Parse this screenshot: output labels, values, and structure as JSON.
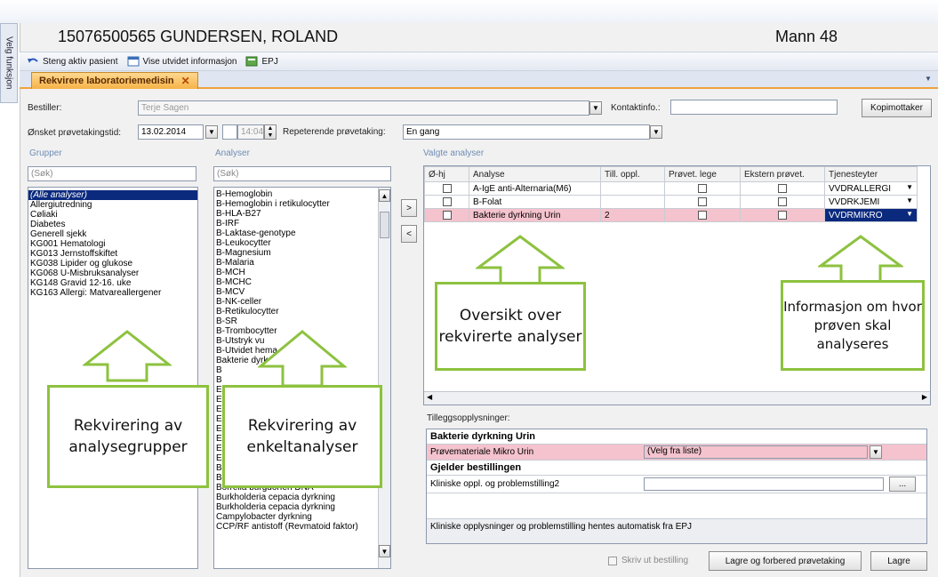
{
  "side_tab": "Velg funksjon",
  "patient": {
    "name": "15076500565 GUNDERSEN, ROLAND",
    "info": "Mann 48"
  },
  "toolbar": {
    "close_patient": "Steng aktiv pasient",
    "extended_info": "Vise utvidet informasjon",
    "epj": "EPJ"
  },
  "tab": {
    "label": "Rekvirere laboratoriemedisin",
    "close": "✕"
  },
  "form": {
    "bestiller_label": "Bestiller:",
    "bestiller_value": "Terje Sagen",
    "kontakt_label": "Kontaktinfo.:",
    "kontakt_value": "",
    "kopimottaker": "Kopimottaker",
    "provetid_label": "Ønsket prøvetakingstid:",
    "date": "13.02.2014",
    "time": "14:04",
    "repeat_label": "Repeterende prøvetaking:",
    "repeat_value": "En gang"
  },
  "grupper": {
    "header": "Grupper",
    "search_placeholder": "(Søk)",
    "items": [
      "(Alle analyser)",
      "Allergiutredning",
      "Cøliaki",
      "Diabetes",
      "Generell sjekk",
      "KG001 Hematologi",
      "KG013 Jernstoffskiftet",
      "KG038 Lipider og glukose",
      "KG068 U-Misbruksanalyser",
      "KG148 Gravid 12-16. uke",
      "KG163 Allergi: Matvareallergener"
    ]
  },
  "analyser": {
    "header": "Analyser",
    "search_placeholder": "(Søk)",
    "items": [
      "B-Hemoglobin",
      "B-Hemoglobin i retikulocytter",
      "B-HLA-B27",
      "B-IRF",
      "B-Laktase-genotype",
      "B-Leukocytter",
      "B-Magnesium",
      "B-Malaria",
      "B-MCH",
      "B-MCHC",
      "B-MCV",
      "B-NK-celler",
      "B-Retikulocytter",
      "B-SR",
      "B-Trombocytter",
      "B-Utstryk vu",
      "B-Utvidet hema",
      "Bakterie dyrkning",
      "B",
      "B",
      "E",
      "E",
      "E",
      "E",
      "E",
      "E",
      "E",
      "E",
      "Bordetella pertussis (kikhoste), paraper",
      "Borrelia antistoff",
      "Borrelia burgdorferi DNA",
      "Burkholderia cepacia dyrkning",
      "Burkholderia cepacia dyrkning",
      "Campylobacter dyrkning",
      "CCP/RF antistoff (Revmatoid faktor)"
    ]
  },
  "move_buttons": {
    "add": ">",
    "remove": "<"
  },
  "valgte": {
    "header": "Valgte analyser",
    "columns": [
      "Ø-hj",
      "Analyse",
      "Till. oppl.",
      "Prøvet. lege",
      "Ekstern prøvet.",
      "Tjenesteyter"
    ],
    "rows": [
      {
        "analyse": "A-IgE anti-Alternaria(M6)",
        "till": "",
        "tjeneste": "VVDRALLERGI"
      },
      {
        "analyse": "B-Folat",
        "till": "",
        "tjeneste": "VVDRKJEMI"
      },
      {
        "analyse": "Bakterie dyrkning Urin",
        "till": "2",
        "tjeneste": "VVDRMIKRO"
      }
    ]
  },
  "tillegg": {
    "header": "Tilleggsopplysninger:",
    "group1": "Bakterie dyrkning Urin",
    "row1_label": "Prøvemateriale Mikro Urin",
    "row1_value": "(Velg fra liste)",
    "group2": "Gjelder bestillingen",
    "row2_label": "Kliniske oppl. og problemstilling2",
    "row2_value": "",
    "ellipsis": "...",
    "note": "Kliniske opplysninger og problemstilling hentes automatisk fra EPJ"
  },
  "footer": {
    "print": "Skriv ut bestilling",
    "prepare": "Lagre og forbered prøvetaking",
    "save": "Lagre"
  },
  "callouts": {
    "groups": "Rekvirering av analysegrupper",
    "single": "Rekvirering av enkeltanalyser",
    "overview": "Oversikt over rekvirerte analyser",
    "info": "Informasjon om hvor prøven skal analyseres"
  },
  "colors": {
    "callout_border": "#8dc23f",
    "selection": "#0b2a7e",
    "highlight_row": "#f4c3cd",
    "tab_orange": "#f6b248"
  }
}
